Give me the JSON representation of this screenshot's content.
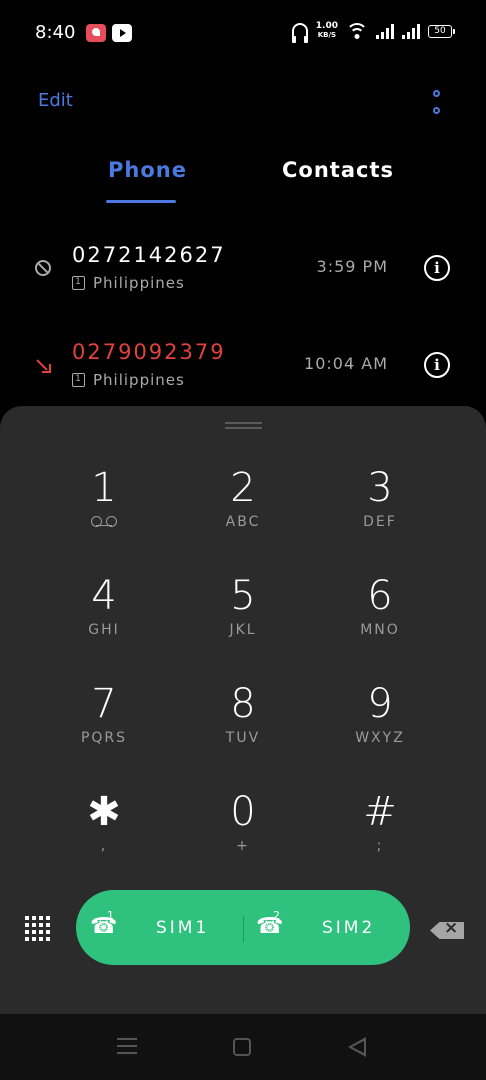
{
  "status_bar": {
    "time": "8:40",
    "net_speed_value": "1.00",
    "net_speed_unit": "KB/S",
    "battery": "50"
  },
  "header": {
    "edit_label": "Edit",
    "tabs": [
      {
        "label": "Phone",
        "active": true
      },
      {
        "label": "Contacts",
        "active": false
      }
    ]
  },
  "call_log": [
    {
      "number": "0272142627",
      "location": "Philippines",
      "sim": "1",
      "time": "3:59 PM",
      "type": "blocked"
    },
    {
      "number": "0279092379",
      "location": "Philippines",
      "sim": "1",
      "time": "10:04 AM",
      "type": "missed"
    }
  ],
  "dialpad": {
    "keys": [
      {
        "digit": "1",
        "letters": ""
      },
      {
        "digit": "2",
        "letters": "ABC"
      },
      {
        "digit": "3",
        "letters": "DEF"
      },
      {
        "digit": "4",
        "letters": "GHI"
      },
      {
        "digit": "5",
        "letters": "JKL"
      },
      {
        "digit": "6",
        "letters": "MNO"
      },
      {
        "digit": "7",
        "letters": "PQRS"
      },
      {
        "digit": "8",
        "letters": "TUV"
      },
      {
        "digit": "9",
        "letters": "WXYZ"
      },
      {
        "digit": "✱",
        "letters": ","
      },
      {
        "digit": "0",
        "letters": "+"
      },
      {
        "digit": "#",
        "letters": ";"
      }
    ],
    "sim1_label": "SIM1",
    "sim2_label": "SIM2",
    "sim1_badge": "1",
    "sim2_badge": "2"
  },
  "colors": {
    "accent": "#4c79e0",
    "missed": "#e2423d",
    "call_button": "#2ec27e",
    "panel": "#2b2b2b"
  }
}
